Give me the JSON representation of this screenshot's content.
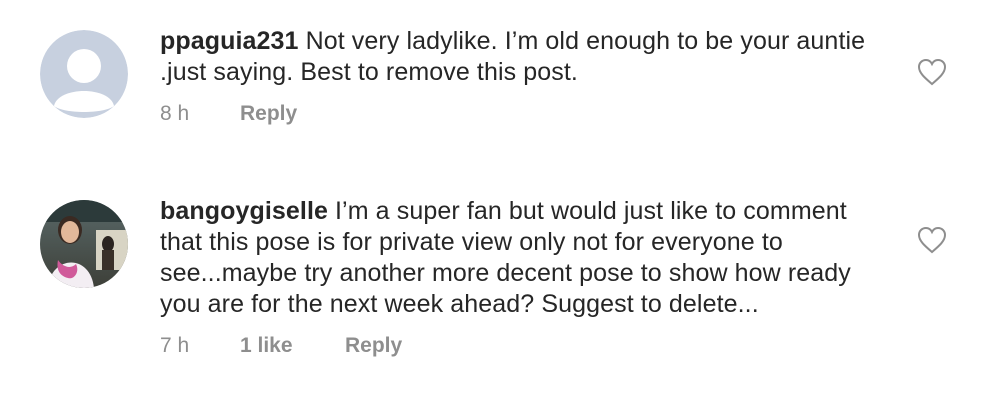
{
  "comments": [
    {
      "username": "ppaguia231",
      "text": "Not very ladylike. I’m old  enough to be your auntie .just saying. Best to remove this post.",
      "time": "8 h",
      "likes": "",
      "reply_label": "Reply",
      "avatar": "default-avatar-icon",
      "icon": "heart-outline-icon"
    },
    {
      "username": "bangoygiselle",
      "text": "I’m a super fan but would just like to comment that this pose is for private view only not for everyone to see...maybe try another more decent pose to show how ready you are for the next week ahead? Suggest to delete...",
      "time": "7 h",
      "likes": "1 like",
      "reply_label": "Reply",
      "avatar": "user-photo",
      "icon": "heart-outline-icon"
    }
  ],
  "colors": {
    "text": "#262626",
    "meta": "#8e8e8e",
    "default_avatar_bg": "#c7d0df"
  }
}
